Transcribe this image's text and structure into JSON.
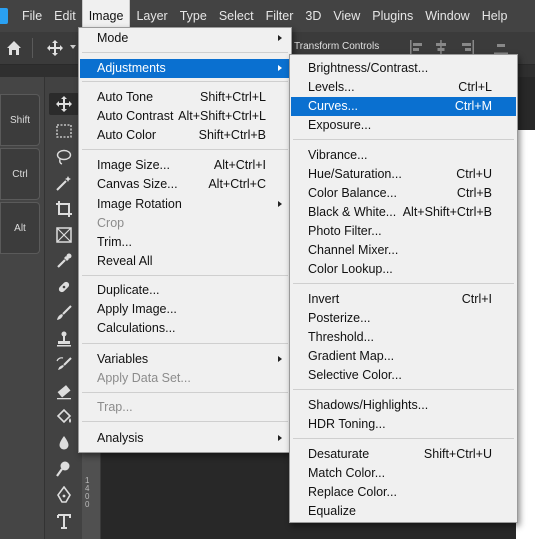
{
  "menubar": {
    "items": [
      "File",
      "Edit",
      "Image",
      "Layer",
      "Type",
      "Select",
      "Filter",
      "3D",
      "View",
      "Plugins",
      "Window",
      "Help"
    ],
    "active": "Image"
  },
  "options_bar": {
    "transform_label": "Transform Controls",
    "icons": [
      "home-icon",
      "move-tool-icon",
      "chevron-down-icon"
    ]
  },
  "modifier_keys": [
    "Shift",
    "Ctrl",
    "Alt"
  ],
  "ruler": {
    "label": "1400"
  },
  "image_menu": {
    "items": [
      {
        "label": "Mode",
        "submenu": true
      },
      {
        "label": "Adjustments",
        "submenu": true,
        "highlighted": true
      },
      {
        "label": "Auto Tone",
        "shortcut": "Shift+Ctrl+L"
      },
      {
        "label": "Auto Contrast",
        "shortcut": "Alt+Shift+Ctrl+L"
      },
      {
        "label": "Auto Color",
        "shortcut": "Shift+Ctrl+B"
      },
      {
        "label": "Image Size...",
        "shortcut": "Alt+Ctrl+I"
      },
      {
        "label": "Canvas Size...",
        "shortcut": "Alt+Ctrl+C"
      },
      {
        "label": "Image Rotation",
        "submenu": true
      },
      {
        "label": "Crop",
        "disabled": true
      },
      {
        "label": "Trim..."
      },
      {
        "label": "Reveal All"
      },
      {
        "label": "Duplicate..."
      },
      {
        "label": "Apply Image..."
      },
      {
        "label": "Calculations..."
      },
      {
        "label": "Variables",
        "submenu": true
      },
      {
        "label": "Apply Data Set...",
        "disabled": true
      },
      {
        "label": "Trap...",
        "disabled": true
      },
      {
        "label": "Analysis",
        "submenu": true
      }
    ]
  },
  "adjustments_menu": {
    "items": [
      {
        "label": "Brightness/Contrast..."
      },
      {
        "label": "Levels...",
        "shortcut": "Ctrl+L"
      },
      {
        "label": "Curves...",
        "shortcut": "Ctrl+M",
        "highlighted": true
      },
      {
        "label": "Exposure..."
      },
      {
        "label": "Vibrance..."
      },
      {
        "label": "Hue/Saturation...",
        "shortcut": "Ctrl+U"
      },
      {
        "label": "Color Balance...",
        "shortcut": "Ctrl+B"
      },
      {
        "label": "Black & White...",
        "shortcut": "Alt+Shift+Ctrl+B"
      },
      {
        "label": "Photo Filter..."
      },
      {
        "label": "Channel Mixer..."
      },
      {
        "label": "Color Lookup..."
      },
      {
        "label": "Invert",
        "shortcut": "Ctrl+I"
      },
      {
        "label": "Posterize..."
      },
      {
        "label": "Threshold..."
      },
      {
        "label": "Gradient Map..."
      },
      {
        "label": "Selective Color..."
      },
      {
        "label": "Shadows/Highlights..."
      },
      {
        "label": "HDR Toning..."
      },
      {
        "label": "Desaturate",
        "shortcut": "Shift+Ctrl+U"
      },
      {
        "label": "Match Color..."
      },
      {
        "label": "Replace Color..."
      },
      {
        "label": "Equalize"
      }
    ]
  },
  "colors": {
    "highlight": "#0a70d0",
    "menu_bg": "#f0f0f0",
    "menubar_bg": "#434343"
  }
}
